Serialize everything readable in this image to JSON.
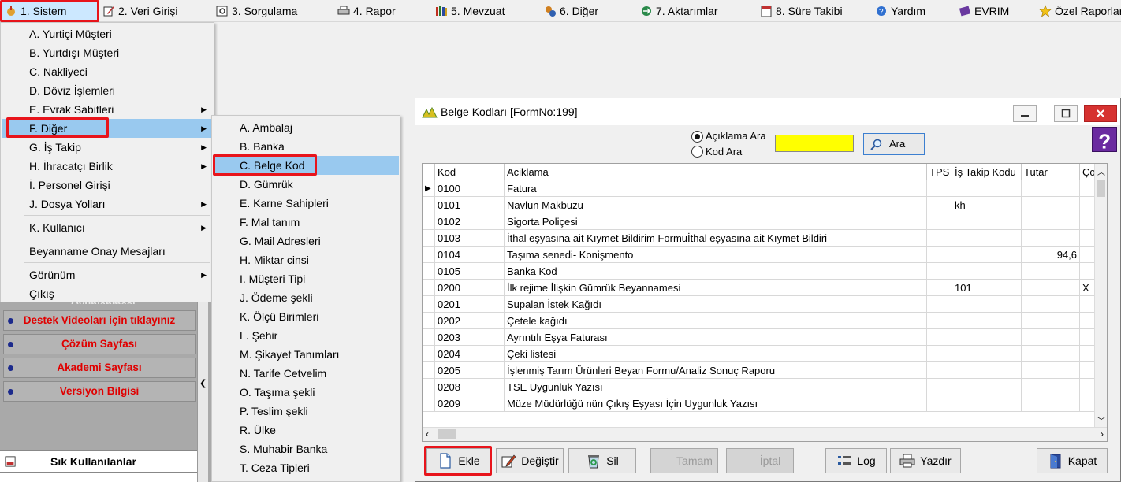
{
  "menubar": {
    "items": [
      {
        "label": "1.  Sistem",
        "icon": "system-icon"
      },
      {
        "label": "2.  Veri Girişi",
        "icon": "edit-icon"
      },
      {
        "label": "3.  Sorgulama",
        "icon": "query-icon"
      },
      {
        "label": "4.  Rapor",
        "icon": "printer-icon"
      },
      {
        "label": "5.  Mevzuat",
        "icon": "books-icon"
      },
      {
        "label": "6.  Diğer",
        "icon": "gears-icon"
      },
      {
        "label": "7.  Aktarımlar",
        "icon": "transfer-icon"
      },
      {
        "label": "8. Süre Takibi",
        "icon": "calendar-icon"
      },
      {
        "label": "Yardım",
        "icon": "help-icon"
      },
      {
        "label": "EVRIM",
        "icon": "book-icon"
      },
      {
        "label": "Özel Raporlar",
        "icon": "star-icon"
      }
    ]
  },
  "sistem_menu": {
    "items": [
      {
        "label": "A.  Yurtiçi Müşteri",
        "arrow": false
      },
      {
        "label": "B.  Yurtdışı Müşteri",
        "arrow": false
      },
      {
        "label": "C.  Nakliyeci",
        "arrow": false
      },
      {
        "label": "D.  Döviz İşlemleri",
        "arrow": false
      },
      {
        "label": "E.  Evrak Sabitleri",
        "arrow": true
      },
      {
        "label": "F.  Diğer",
        "arrow": true
      },
      {
        "label": "G.  İş Takip",
        "arrow": true
      },
      {
        "label": "H.  İhracatçı Birlik",
        "arrow": true
      },
      {
        "label": "İ.   Personel Girişi",
        "arrow": false
      },
      {
        "label": "J.  Dosya Yolları",
        "arrow": true
      },
      {
        "label": "K.  Kullanıcı",
        "arrow": true
      },
      {
        "label": "Beyanname Onay Mesajları",
        "arrow": false
      },
      {
        "label": "Görünüm",
        "arrow": true
      },
      {
        "label": "Çıkış",
        "arrow": false
      }
    ]
  },
  "diger_submenu": {
    "items": [
      "A.  Ambalaj",
      "B.  Banka",
      "C.  Belge Kod",
      "D.  Gümrük",
      "E.  Karne Sahipleri",
      "F.  Mal tanım",
      "G.  Mail Adresleri",
      "H.  Miktar cinsi",
      "I.  Müşteri Tipi",
      "J.  Ödeme şekli",
      "K.  Ölçü Birimleri",
      "L.  Şehir",
      "M.  Şikayet Tanımları",
      "N.  Tarife Cetvelim",
      "O.  Taşıma şekli",
      "P.  Teslim şekli",
      "R.  Ülke",
      "S.  Muhabir Banka",
      "T.  Ceza Tipleri"
    ]
  },
  "left_panel": {
    "partial_text": "Oyunlanması",
    "links": [
      "Destek Videoları için tıklayınız",
      "Çözüm Sayfası",
      "Akademi Sayfası",
      "Versiyon Bilgisi"
    ],
    "favorites_title": "Sık Kullanılanlar"
  },
  "form": {
    "title": "Belge Kodları [FormNo:199]",
    "search": {
      "radio_desc": "Açıklama Ara",
      "radio_code": "Kod Ara",
      "input_value": "",
      "button": "Ara"
    },
    "columns": [
      "Kod",
      "Aciklama",
      "TPS",
      "İş Takip Kodu",
      "Tutar",
      "Çok"
    ],
    "rows": [
      {
        "kod": "0100",
        "aciklama": "Fatura",
        "tps": "",
        "is_takip": "",
        "tutar": "",
        "cok": ""
      },
      {
        "kod": "0101",
        "aciklama": "Navlun Makbuzu",
        "tps": "",
        "is_takip": "kh",
        "tutar": "",
        "cok": ""
      },
      {
        "kod": "0102",
        "aciklama": "Sigorta Poliçesi",
        "tps": "",
        "is_takip": "",
        "tutar": "",
        "cok": ""
      },
      {
        "kod": "0103",
        "aciklama": "İthal eşyasına ait Kıymet Bildirim Formuİthal eşyasına ait Kıymet Bildiri",
        "tps": "",
        "is_takip": "",
        "tutar": "",
        "cok": ""
      },
      {
        "kod": "0104",
        "aciklama": "Taşıma senedi- Konişmento",
        "tps": "",
        "is_takip": "",
        "tutar": "94,6",
        "cok": ""
      },
      {
        "kod": "0105",
        "aciklama": "Banka Kod",
        "tps": "",
        "is_takip": "",
        "tutar": "",
        "cok": ""
      },
      {
        "kod": "0200",
        "aciklama": "İlk rejime İlişkin Gümrük Beyannamesi",
        "tps": "",
        "is_takip": "101",
        "tutar": "",
        "cok": "X"
      },
      {
        "kod": "0201",
        "aciklama": "Supalan İstek Kağıdı",
        "tps": "",
        "is_takip": "",
        "tutar": "",
        "cok": ""
      },
      {
        "kod": "0202",
        "aciklama": "Çetele kağıdı",
        "tps": "",
        "is_takip": "",
        "tutar": "",
        "cok": ""
      },
      {
        "kod": "0203",
        "aciklama": "Ayrıntılı Eşya Faturası",
        "tps": "",
        "is_takip": "",
        "tutar": "",
        "cok": ""
      },
      {
        "kod": "0204",
        "aciklama": "Çeki listesi",
        "tps": "",
        "is_takip": "",
        "tutar": "",
        "cok": ""
      },
      {
        "kod": "0205",
        "aciklama": "İşlenmiş Tarım Ürünleri Beyan Formu/Analiz Sonuç Raporu",
        "tps": "",
        "is_takip": "",
        "tutar": "",
        "cok": ""
      },
      {
        "kod": "0208",
        "aciklama": "TSE Uygunluk Yazısı",
        "tps": "",
        "is_takip": "",
        "tutar": "",
        "cok": ""
      },
      {
        "kod": "0209",
        "aciklama": "Müze Müdürlüğü nün Çıkış Eşyası İçin Uygunluk Yazısı",
        "tps": "",
        "is_takip": "",
        "tutar": "",
        "cok": ""
      }
    ],
    "buttons": {
      "ekle": "Ekle",
      "degistir": "Değiştir",
      "sil": "Sil",
      "tamam": "Tamam",
      "iptal": "İptal",
      "log": "Log",
      "yazdir": "Yazdır",
      "kapat": "Kapat"
    }
  },
  "colors": {
    "highlight": "#99c9ef",
    "annotation_red": "#e8141b",
    "search_input": "#ffff00",
    "link_red": "#e00000"
  }
}
